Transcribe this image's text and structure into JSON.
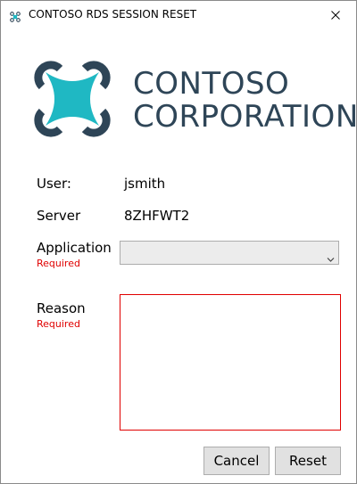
{
  "window": {
    "title": "CONTOSO RDS SESSION RESET",
    "app_icon": "drone-logo-icon",
    "close_icon": "close-icon"
  },
  "brand": {
    "line1": "CONTOSO",
    "line2": "CORPORATION",
    "logo_icon": "drone-logo-icon",
    "colors": {
      "ring": "#2e4557",
      "body": "#1fb8c3"
    }
  },
  "form": {
    "user_label": "User:",
    "user_value": "jsmith",
    "server_label": "Server",
    "server_value": "8ZHFWT2",
    "application_label": "Application",
    "application_required": "Required",
    "application_selected": "",
    "application_chevron": "chevron-down-icon",
    "reason_label": "Reason",
    "reason_required": "Required",
    "reason_value": "",
    "required_color": "#e00000"
  },
  "buttons": {
    "cancel": "Cancel",
    "reset": "Reset"
  }
}
